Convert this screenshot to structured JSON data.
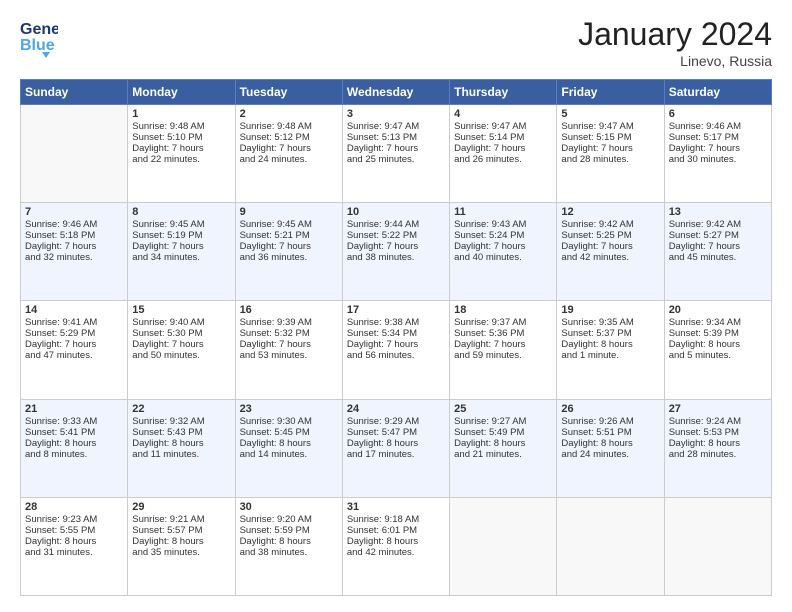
{
  "header": {
    "logo_general": "General",
    "logo_blue": "Blue",
    "title": "January 2024",
    "subtitle": "Linevo, Russia"
  },
  "days_of_week": [
    "Sunday",
    "Monday",
    "Tuesday",
    "Wednesday",
    "Thursday",
    "Friday",
    "Saturday"
  ],
  "weeks": [
    [
      {
        "day": "",
        "data": []
      },
      {
        "day": "1",
        "data": [
          "Sunrise: 9:48 AM",
          "Sunset: 5:10 PM",
          "Daylight: 7 hours",
          "and 22 minutes."
        ]
      },
      {
        "day": "2",
        "data": [
          "Sunrise: 9:48 AM",
          "Sunset: 5:12 PM",
          "Daylight: 7 hours",
          "and 24 minutes."
        ]
      },
      {
        "day": "3",
        "data": [
          "Sunrise: 9:47 AM",
          "Sunset: 5:13 PM",
          "Daylight: 7 hours",
          "and 25 minutes."
        ]
      },
      {
        "day": "4",
        "data": [
          "Sunrise: 9:47 AM",
          "Sunset: 5:14 PM",
          "Daylight: 7 hours",
          "and 26 minutes."
        ]
      },
      {
        "day": "5",
        "data": [
          "Sunrise: 9:47 AM",
          "Sunset: 5:15 PM",
          "Daylight: 7 hours",
          "and 28 minutes."
        ]
      },
      {
        "day": "6",
        "data": [
          "Sunrise: 9:46 AM",
          "Sunset: 5:17 PM",
          "Daylight: 7 hours",
          "and 30 minutes."
        ]
      }
    ],
    [
      {
        "day": "7",
        "data": [
          "Sunrise: 9:46 AM",
          "Sunset: 5:18 PM",
          "Daylight: 7 hours",
          "and 32 minutes."
        ]
      },
      {
        "day": "8",
        "data": [
          "Sunrise: 9:45 AM",
          "Sunset: 5:19 PM",
          "Daylight: 7 hours",
          "and 34 minutes."
        ]
      },
      {
        "day": "9",
        "data": [
          "Sunrise: 9:45 AM",
          "Sunset: 5:21 PM",
          "Daylight: 7 hours",
          "and 36 minutes."
        ]
      },
      {
        "day": "10",
        "data": [
          "Sunrise: 9:44 AM",
          "Sunset: 5:22 PM",
          "Daylight: 7 hours",
          "and 38 minutes."
        ]
      },
      {
        "day": "11",
        "data": [
          "Sunrise: 9:43 AM",
          "Sunset: 5:24 PM",
          "Daylight: 7 hours",
          "and 40 minutes."
        ]
      },
      {
        "day": "12",
        "data": [
          "Sunrise: 9:42 AM",
          "Sunset: 5:25 PM",
          "Daylight: 7 hours",
          "and 42 minutes."
        ]
      },
      {
        "day": "13",
        "data": [
          "Sunrise: 9:42 AM",
          "Sunset: 5:27 PM",
          "Daylight: 7 hours",
          "and 45 minutes."
        ]
      }
    ],
    [
      {
        "day": "14",
        "data": [
          "Sunrise: 9:41 AM",
          "Sunset: 5:29 PM",
          "Daylight: 7 hours",
          "and 47 minutes."
        ]
      },
      {
        "day": "15",
        "data": [
          "Sunrise: 9:40 AM",
          "Sunset: 5:30 PM",
          "Daylight: 7 hours",
          "and 50 minutes."
        ]
      },
      {
        "day": "16",
        "data": [
          "Sunrise: 9:39 AM",
          "Sunset: 5:32 PM",
          "Daylight: 7 hours",
          "and 53 minutes."
        ]
      },
      {
        "day": "17",
        "data": [
          "Sunrise: 9:38 AM",
          "Sunset: 5:34 PM",
          "Daylight: 7 hours",
          "and 56 minutes."
        ]
      },
      {
        "day": "18",
        "data": [
          "Sunrise: 9:37 AM",
          "Sunset: 5:36 PM",
          "Daylight: 7 hours",
          "and 59 minutes."
        ]
      },
      {
        "day": "19",
        "data": [
          "Sunrise: 9:35 AM",
          "Sunset: 5:37 PM",
          "Daylight: 8 hours",
          "and 1 minute."
        ]
      },
      {
        "day": "20",
        "data": [
          "Sunrise: 9:34 AM",
          "Sunset: 5:39 PM",
          "Daylight: 8 hours",
          "and 5 minutes."
        ]
      }
    ],
    [
      {
        "day": "21",
        "data": [
          "Sunrise: 9:33 AM",
          "Sunset: 5:41 PM",
          "Daylight: 8 hours",
          "and 8 minutes."
        ]
      },
      {
        "day": "22",
        "data": [
          "Sunrise: 9:32 AM",
          "Sunset: 5:43 PM",
          "Daylight: 8 hours",
          "and 11 minutes."
        ]
      },
      {
        "day": "23",
        "data": [
          "Sunrise: 9:30 AM",
          "Sunset: 5:45 PM",
          "Daylight: 8 hours",
          "and 14 minutes."
        ]
      },
      {
        "day": "24",
        "data": [
          "Sunrise: 9:29 AM",
          "Sunset: 5:47 PM",
          "Daylight: 8 hours",
          "and 17 minutes."
        ]
      },
      {
        "day": "25",
        "data": [
          "Sunrise: 9:27 AM",
          "Sunset: 5:49 PM",
          "Daylight: 8 hours",
          "and 21 minutes."
        ]
      },
      {
        "day": "26",
        "data": [
          "Sunrise: 9:26 AM",
          "Sunset: 5:51 PM",
          "Daylight: 8 hours",
          "and 24 minutes."
        ]
      },
      {
        "day": "27",
        "data": [
          "Sunrise: 9:24 AM",
          "Sunset: 5:53 PM",
          "Daylight: 8 hours",
          "and 28 minutes."
        ]
      }
    ],
    [
      {
        "day": "28",
        "data": [
          "Sunrise: 9:23 AM",
          "Sunset: 5:55 PM",
          "Daylight: 8 hours",
          "and 31 minutes."
        ]
      },
      {
        "day": "29",
        "data": [
          "Sunrise: 9:21 AM",
          "Sunset: 5:57 PM",
          "Daylight: 8 hours",
          "and 35 minutes."
        ]
      },
      {
        "day": "30",
        "data": [
          "Sunrise: 9:20 AM",
          "Sunset: 5:59 PM",
          "Daylight: 8 hours",
          "and 38 minutes."
        ]
      },
      {
        "day": "31",
        "data": [
          "Sunrise: 9:18 AM",
          "Sunset: 6:01 PM",
          "Daylight: 8 hours",
          "and 42 minutes."
        ]
      },
      {
        "day": "",
        "data": []
      },
      {
        "day": "",
        "data": []
      },
      {
        "day": "",
        "data": []
      }
    ]
  ]
}
